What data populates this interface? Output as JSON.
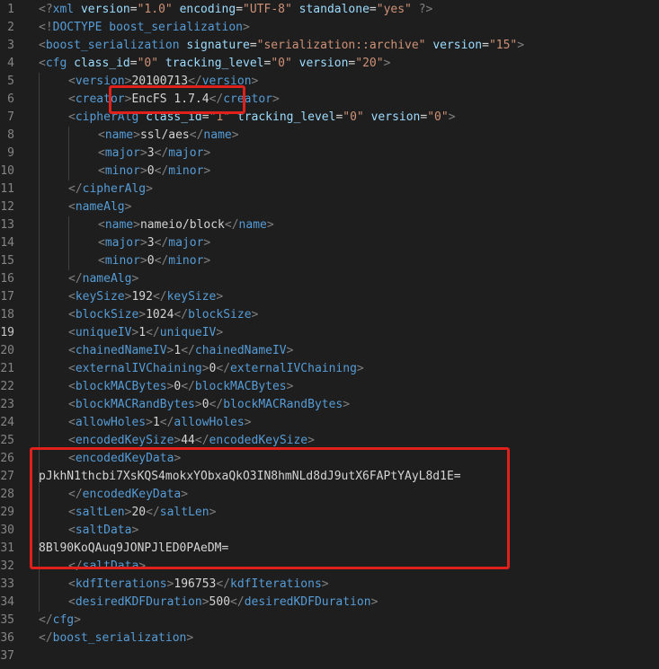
{
  "editor": {
    "active_line": 19,
    "colors": {
      "background": "#1e1e1e",
      "bracket": "#808080",
      "tag": "#569cd6",
      "attribute": "#9cdcfe",
      "value": "#ce9178",
      "text": "#d4d4d4",
      "line_number": "#858585",
      "highlight_box": "#e0201b"
    },
    "lines": [
      {
        "n": "1",
        "indent": 0,
        "tokens": [
          [
            "t",
            "<?"
          ],
          [
            "n",
            "xml"
          ],
          [
            "x",
            " "
          ],
          [
            "a",
            "version"
          ],
          [
            "x",
            "="
          ],
          [
            "v",
            "\"1.0\""
          ],
          [
            "x",
            " "
          ],
          [
            "a",
            "encoding"
          ],
          [
            "x",
            "="
          ],
          [
            "v",
            "\"UTF-8\""
          ],
          [
            "x",
            " "
          ],
          [
            "a",
            "standalone"
          ],
          [
            "x",
            "="
          ],
          [
            "v",
            "\"yes\""
          ],
          [
            "x",
            " "
          ],
          [
            "t",
            "?>"
          ]
        ]
      },
      {
        "n": "2",
        "indent": 0,
        "tokens": [
          [
            "t",
            "<!"
          ],
          [
            "n",
            "DOCTYPE boost_serialization"
          ],
          [
            "t",
            ">"
          ]
        ]
      },
      {
        "n": "3",
        "indent": 0,
        "tokens": [
          [
            "t",
            "<"
          ],
          [
            "n",
            "boost_serialization"
          ],
          [
            "x",
            " "
          ],
          [
            "a",
            "signature"
          ],
          [
            "x",
            "="
          ],
          [
            "v",
            "\"serialization::archive\""
          ],
          [
            "x",
            " "
          ],
          [
            "a",
            "version"
          ],
          [
            "x",
            "="
          ],
          [
            "v",
            "\"15\""
          ],
          [
            "t",
            ">"
          ]
        ]
      },
      {
        "n": "4",
        "indent": 0,
        "tokens": [
          [
            "t",
            "<"
          ],
          [
            "n",
            "cfg"
          ],
          [
            "x",
            " "
          ],
          [
            "a",
            "class_id"
          ],
          [
            "x",
            "="
          ],
          [
            "v",
            "\"0\""
          ],
          [
            "x",
            " "
          ],
          [
            "a",
            "tracking_level"
          ],
          [
            "x",
            "="
          ],
          [
            "v",
            "\"0\""
          ],
          [
            "x",
            " "
          ],
          [
            "a",
            "version"
          ],
          [
            "x",
            "="
          ],
          [
            "v",
            "\"20\""
          ],
          [
            "t",
            ">"
          ]
        ]
      },
      {
        "n": "5",
        "indent": 1,
        "tokens": [
          [
            "t",
            "<"
          ],
          [
            "n",
            "version"
          ],
          [
            "t",
            ">"
          ],
          [
            "x",
            "20100713"
          ],
          [
            "t",
            "</"
          ],
          [
            "n",
            "version"
          ],
          [
            "t",
            ">"
          ]
        ]
      },
      {
        "n": "6",
        "indent": 1,
        "tokens": [
          [
            "t",
            "<"
          ],
          [
            "n",
            "creator"
          ],
          [
            "t",
            ">"
          ],
          [
            "x",
            "EncFS 1.7.4"
          ],
          [
            "t",
            "</"
          ],
          [
            "n",
            "creator"
          ],
          [
            "t",
            ">"
          ]
        ]
      },
      {
        "n": "7",
        "indent": 1,
        "tokens": [
          [
            "t",
            "<"
          ],
          [
            "n",
            "cipherAlg"
          ],
          [
            "x",
            " "
          ],
          [
            "a",
            "class_id"
          ],
          [
            "x",
            "="
          ],
          [
            "v",
            "\"1\""
          ],
          [
            "x",
            " "
          ],
          [
            "a",
            "tracking_level"
          ],
          [
            "x",
            "="
          ],
          [
            "v",
            "\"0\""
          ],
          [
            "x",
            " "
          ],
          [
            "a",
            "version"
          ],
          [
            "x",
            "="
          ],
          [
            "v",
            "\"0\""
          ],
          [
            "t",
            ">"
          ]
        ]
      },
      {
        "n": "8",
        "indent": 2,
        "tokens": [
          [
            "t",
            "<"
          ],
          [
            "n",
            "name"
          ],
          [
            "t",
            ">"
          ],
          [
            "x",
            "ssl/aes"
          ],
          [
            "t",
            "</"
          ],
          [
            "n",
            "name"
          ],
          [
            "t",
            ">"
          ]
        ]
      },
      {
        "n": "9",
        "indent": 2,
        "tokens": [
          [
            "t",
            "<"
          ],
          [
            "n",
            "major"
          ],
          [
            "t",
            ">"
          ],
          [
            "x",
            "3"
          ],
          [
            "t",
            "</"
          ],
          [
            "n",
            "major"
          ],
          [
            "t",
            ">"
          ]
        ]
      },
      {
        "n": "10",
        "indent": 2,
        "tokens": [
          [
            "t",
            "<"
          ],
          [
            "n",
            "minor"
          ],
          [
            "t",
            ">"
          ],
          [
            "x",
            "0"
          ],
          [
            "t",
            "</"
          ],
          [
            "n",
            "minor"
          ],
          [
            "t",
            ">"
          ]
        ]
      },
      {
        "n": "11",
        "indent": 1,
        "tokens": [
          [
            "t",
            "</"
          ],
          [
            "n",
            "cipherAlg"
          ],
          [
            "t",
            ">"
          ]
        ]
      },
      {
        "n": "12",
        "indent": 1,
        "tokens": [
          [
            "t",
            "<"
          ],
          [
            "n",
            "nameAlg"
          ],
          [
            "t",
            ">"
          ]
        ]
      },
      {
        "n": "13",
        "indent": 2,
        "tokens": [
          [
            "t",
            "<"
          ],
          [
            "n",
            "name"
          ],
          [
            "t",
            ">"
          ],
          [
            "x",
            "nameio/block"
          ],
          [
            "t",
            "</"
          ],
          [
            "n",
            "name"
          ],
          [
            "t",
            ">"
          ]
        ]
      },
      {
        "n": "14",
        "indent": 2,
        "tokens": [
          [
            "t",
            "<"
          ],
          [
            "n",
            "major"
          ],
          [
            "t",
            ">"
          ],
          [
            "x",
            "3"
          ],
          [
            "t",
            "</"
          ],
          [
            "n",
            "major"
          ],
          [
            "t",
            ">"
          ]
        ]
      },
      {
        "n": "15",
        "indent": 2,
        "tokens": [
          [
            "t",
            "<"
          ],
          [
            "n",
            "minor"
          ],
          [
            "t",
            ">"
          ],
          [
            "x",
            "0"
          ],
          [
            "t",
            "</"
          ],
          [
            "n",
            "minor"
          ],
          [
            "t",
            ">"
          ]
        ]
      },
      {
        "n": "16",
        "indent": 1,
        "tokens": [
          [
            "t",
            "</"
          ],
          [
            "n",
            "nameAlg"
          ],
          [
            "t",
            ">"
          ]
        ]
      },
      {
        "n": "17",
        "indent": 1,
        "tokens": [
          [
            "t",
            "<"
          ],
          [
            "n",
            "keySize"
          ],
          [
            "t",
            ">"
          ],
          [
            "x",
            "192"
          ],
          [
            "t",
            "</"
          ],
          [
            "n",
            "keySize"
          ],
          [
            "t",
            ">"
          ]
        ]
      },
      {
        "n": "18",
        "indent": 1,
        "tokens": [
          [
            "t",
            "<"
          ],
          [
            "n",
            "blockSize"
          ],
          [
            "t",
            ">"
          ],
          [
            "x",
            "1024"
          ],
          [
            "t",
            "</"
          ],
          [
            "n",
            "blockSize"
          ],
          [
            "t",
            ">"
          ]
        ]
      },
      {
        "n": "19",
        "indent": 1,
        "tokens": [
          [
            "t",
            "<"
          ],
          [
            "n",
            "uniqueIV"
          ],
          [
            "t",
            ">"
          ],
          [
            "x",
            "1"
          ],
          [
            "t",
            "</"
          ],
          [
            "n",
            "uniqueIV"
          ],
          [
            "t",
            ">"
          ]
        ]
      },
      {
        "n": "20",
        "indent": 1,
        "tokens": [
          [
            "t",
            "<"
          ],
          [
            "n",
            "chainedNameIV"
          ],
          [
            "t",
            ">"
          ],
          [
            "x",
            "1"
          ],
          [
            "t",
            "</"
          ],
          [
            "n",
            "chainedNameIV"
          ],
          [
            "t",
            ">"
          ]
        ]
      },
      {
        "n": "21",
        "indent": 1,
        "tokens": [
          [
            "t",
            "<"
          ],
          [
            "n",
            "externalIVChaining"
          ],
          [
            "t",
            ">"
          ],
          [
            "x",
            "0"
          ],
          [
            "t",
            "</"
          ],
          [
            "n",
            "externalIVChaining"
          ],
          [
            "t",
            ">"
          ]
        ]
      },
      {
        "n": "22",
        "indent": 1,
        "tokens": [
          [
            "t",
            "<"
          ],
          [
            "n",
            "blockMACBytes"
          ],
          [
            "t",
            ">"
          ],
          [
            "x",
            "0"
          ],
          [
            "t",
            "</"
          ],
          [
            "n",
            "blockMACBytes"
          ],
          [
            "t",
            ">"
          ]
        ]
      },
      {
        "n": "23",
        "indent": 1,
        "tokens": [
          [
            "t",
            "<"
          ],
          [
            "n",
            "blockMACRandBytes"
          ],
          [
            "t",
            ">"
          ],
          [
            "x",
            "0"
          ],
          [
            "t",
            "</"
          ],
          [
            "n",
            "blockMACRandBytes"
          ],
          [
            "t",
            ">"
          ]
        ]
      },
      {
        "n": "24",
        "indent": 1,
        "tokens": [
          [
            "t",
            "<"
          ],
          [
            "n",
            "allowHoles"
          ],
          [
            "t",
            ">"
          ],
          [
            "x",
            "1"
          ],
          [
            "t",
            "</"
          ],
          [
            "n",
            "allowHoles"
          ],
          [
            "t",
            ">"
          ]
        ]
      },
      {
        "n": "25",
        "indent": 1,
        "tokens": [
          [
            "t",
            "<"
          ],
          [
            "n",
            "encodedKeySize"
          ],
          [
            "t",
            ">"
          ],
          [
            "x",
            "44"
          ],
          [
            "t",
            "</"
          ],
          [
            "n",
            "encodedKeySize"
          ],
          [
            "t",
            ">"
          ]
        ]
      },
      {
        "n": "26",
        "indent": 1,
        "tokens": [
          [
            "t",
            "<"
          ],
          [
            "n",
            "encodedKeyData"
          ],
          [
            "t",
            ">"
          ]
        ]
      },
      {
        "n": "27",
        "indent": 0,
        "tokens": [
          [
            "x",
            "pJkhN1thcbi7XsKQS4mokxYObxaQkO3IN8hmNLd8dJ9utX6FAPtYAyL8d1E="
          ]
        ]
      },
      {
        "n": "28",
        "indent": 1,
        "tokens": [
          [
            "t",
            "</"
          ],
          [
            "n",
            "encodedKeyData"
          ],
          [
            "t",
            ">"
          ]
        ]
      },
      {
        "n": "29",
        "indent": 1,
        "tokens": [
          [
            "t",
            "<"
          ],
          [
            "n",
            "saltLen"
          ],
          [
            "t",
            ">"
          ],
          [
            "x",
            "20"
          ],
          [
            "t",
            "</"
          ],
          [
            "n",
            "saltLen"
          ],
          [
            "t",
            ">"
          ]
        ]
      },
      {
        "n": "30",
        "indent": 1,
        "tokens": [
          [
            "t",
            "<"
          ],
          [
            "n",
            "saltData"
          ],
          [
            "t",
            ">"
          ]
        ]
      },
      {
        "n": "31",
        "indent": 0,
        "tokens": [
          [
            "x",
            "8Bl90KoQAuq9JONPJlED0PAeDM="
          ]
        ]
      },
      {
        "n": "32",
        "indent": 1,
        "tokens": [
          [
            "t",
            "</"
          ],
          [
            "n",
            "saltData"
          ],
          [
            "t",
            ">"
          ]
        ]
      },
      {
        "n": "33",
        "indent": 1,
        "tokens": [
          [
            "t",
            "<"
          ],
          [
            "n",
            "kdfIterations"
          ],
          [
            "t",
            ">"
          ],
          [
            "x",
            "196753"
          ],
          [
            "t",
            "</"
          ],
          [
            "n",
            "kdfIterations"
          ],
          [
            "t",
            ">"
          ]
        ]
      },
      {
        "n": "34",
        "indent": 1,
        "tokens": [
          [
            "t",
            "<"
          ],
          [
            "n",
            "desiredKDFDuration"
          ],
          [
            "t",
            ">"
          ],
          [
            "x",
            "500"
          ],
          [
            "t",
            "</"
          ],
          [
            "n",
            "desiredKDFDuration"
          ],
          [
            "t",
            ">"
          ]
        ]
      },
      {
        "n": "35",
        "indent": 0,
        "tokens": [
          [
            "t",
            "</"
          ],
          [
            "n",
            "cfg"
          ],
          [
            "t",
            ">"
          ]
        ]
      },
      {
        "n": "36",
        "indent": 0,
        "tokens": [
          [
            "t",
            "</"
          ],
          [
            "n",
            "boost_serialization"
          ],
          [
            "t",
            ">"
          ]
        ]
      },
      {
        "n": "37",
        "indent": 0,
        "tokens": []
      }
    ]
  }
}
